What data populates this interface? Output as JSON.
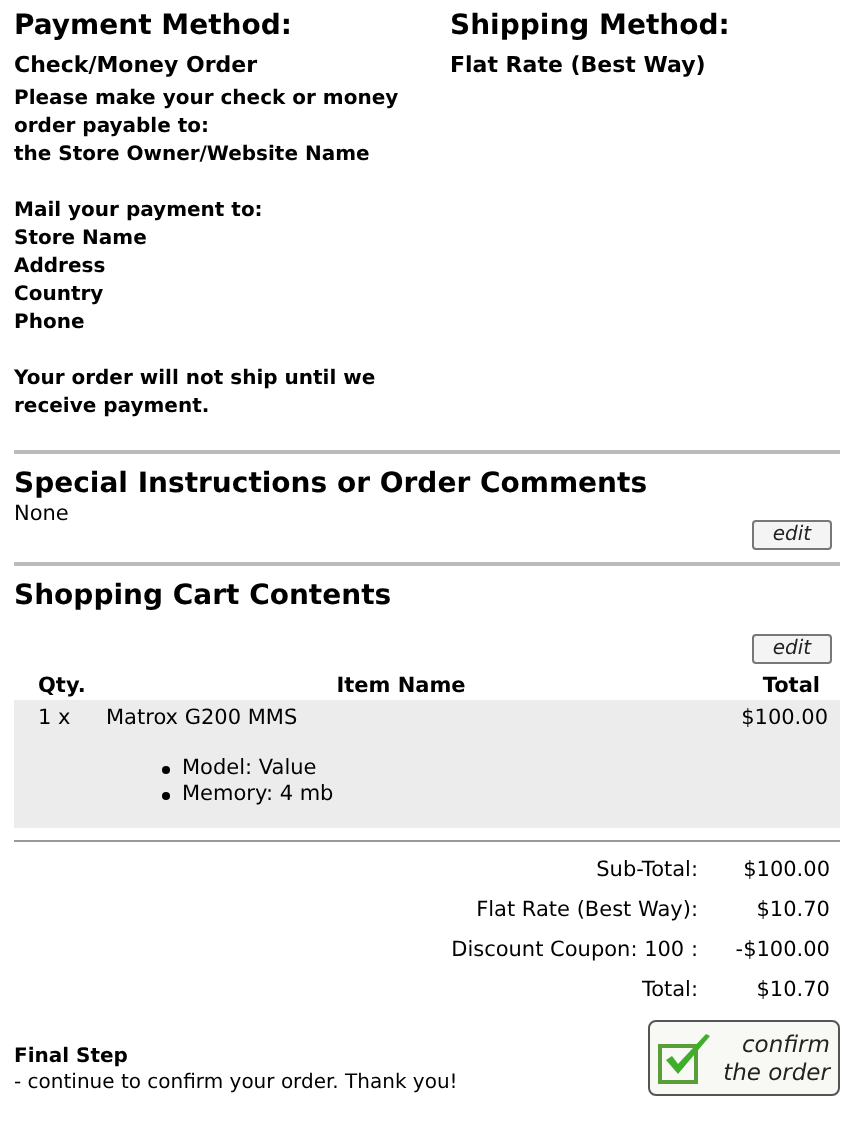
{
  "payment": {
    "heading": "Payment Method:",
    "method": "Check/Money Order",
    "paragraphs": [
      [
        "Please make your check or money",
        "order payable to:",
        "the Store Owner/Website Name"
      ],
      [
        "Mail your payment to:",
        "Store Name",
        "Address",
        "Country",
        "Phone"
      ],
      [
        "Your order will not ship until we",
        "receive payment."
      ]
    ]
  },
  "shipping": {
    "heading": "Shipping Method:",
    "method": "Flat Rate (Best Way)"
  },
  "comments": {
    "heading": "Special Instructions or Order Comments",
    "text": "None",
    "edit": "edit"
  },
  "cart": {
    "heading": "Shopping Cart Contents",
    "edit": "edit",
    "columns": [
      "Qty.",
      "Item Name",
      "Total"
    ],
    "rows": [
      {
        "qty": "1 x",
        "name": "Matrox G200 MMS",
        "total": "$100.00",
        "attributes": [
          "Model: Value",
          "Memory: 4 mb"
        ]
      }
    ]
  },
  "totals": [
    {
      "label": "Sub-Total:",
      "value": "$100.00"
    },
    {
      "label": "Flat Rate (Best Way):",
      "value": "$10.70"
    },
    {
      "label": "Discount Coupon: 100 :",
      "value": "-$100.00"
    },
    {
      "label": "Total:",
      "value": "$10.70"
    }
  ],
  "final": {
    "title": "Final Step",
    "text": "- continue to confirm your order. Thank you!",
    "confirm": [
      "confirm",
      "the order"
    ]
  }
}
